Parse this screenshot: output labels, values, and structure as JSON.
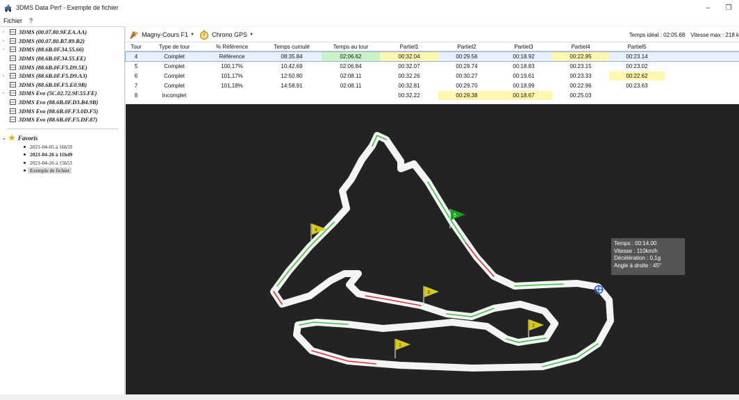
{
  "window": {
    "title": "3DMS Data Perf - Exemple de fichier",
    "minimize_glyph": "–",
    "restore_glyph": "❐"
  },
  "menu": [
    "Fichier",
    "?"
  ],
  "devices": [
    "3DMS (00.07.80.9F.EA.AA)",
    "3DMS (00.07.80.B7.89.B2)",
    "3DMS (88.6B.0F.34.55.66)",
    "3DMS (88.6B.0F.34.55.EE)",
    "3DMS (88.6B.0F.F5.D9.5E)",
    "3DMS (88.6B.0F.F5.D9.A3)",
    "3DMS (88.6B.0F.F5.E0.9B)",
    "3DMS Evo (5C.02.72.9F.55.FE)",
    "3DMS Evo (88.6B.0F.D3.B4.9B)",
    "3DMS Evo (88.6B.0F.F3.0D.F5)",
    "3DMS Evo (88.6B.0F.F5.DF.87)"
  ],
  "favorites": {
    "label": "Favoris",
    "items": [
      {
        "label": "2021-04-05 à 16h59",
        "bold": false,
        "selected": false
      },
      {
        "label": "2021-04-26 à 11h49",
        "bold": true,
        "selected": false
      },
      {
        "label": "2021-04-26 à 15h53",
        "bold": false,
        "selected": false
      },
      {
        "label": "Exemple de fichier",
        "bold": false,
        "selected": true
      }
    ]
  },
  "toolbar": {
    "circuit": "Magny-Cours F1",
    "timing": "Chrono GPS",
    "ideal_time": "Temps idéal : 02:05.68",
    "max_speed": "Vitesse max : 218 k"
  },
  "table": {
    "columns": [
      "Tour",
      "Type de tour",
      "% Référence",
      "Temps cumulé",
      "Temps au tour",
      "Partiel1",
      "Partiel2",
      "Partiel3",
      "Partiel4",
      "Partiel5"
    ],
    "rows": [
      {
        "cells": [
          "4",
          "Complet",
          "Référence",
          "08:35.84",
          "02:06.62",
          "00:32.04",
          "00:29.56",
          "00:18.92",
          "00:22.95",
          "00:23.14"
        ],
        "selected": true,
        "highlights": {
          "4": "green",
          "5": "yellow",
          "8": "yellow"
        }
      },
      {
        "cells": [
          "5",
          "Complet",
          "100,17%",
          "10:42.69",
          "02:06.84",
          "00:32.07",
          "00:29.74",
          "00:18.83",
          "00:23.15",
          "00:23.02"
        ],
        "selected": false,
        "highlights": {}
      },
      {
        "cells": [
          "6",
          "Complet",
          "101,17%",
          "12:50.80",
          "02:08.11",
          "00:32.26",
          "00:30.27",
          "00:19.61",
          "00:23.33",
          "00:22.62"
        ],
        "selected": false,
        "highlights": {
          "9": "yellow"
        }
      },
      {
        "cells": [
          "7",
          "Complet",
          "101,18%",
          "14:58.91",
          "02:08.11",
          "00:32.81",
          "00:29.70",
          "00:18.99",
          "00:22.96",
          "00:23.63"
        ],
        "selected": false,
        "highlights": {}
      },
      {
        "cells": [
          "8",
          "Incomplet",
          "",
          "",
          "",
          "00:32.22",
          "00:29.38",
          "00:18.67",
          "00:25.03",
          ""
        ],
        "selected": false,
        "highlights": {
          "6": "yellow",
          "7": "yellow"
        }
      }
    ]
  },
  "track": {
    "flags": [
      {
        "label": "1",
        "color": "yellow"
      },
      {
        "label": "2",
        "color": "yellow"
      },
      {
        "label": "3",
        "color": "yellow"
      },
      {
        "label": "4",
        "color": "yellow"
      },
      {
        "label": "5",
        "color": "green"
      }
    ],
    "tooltip": {
      "time": "Temps : 00:14.00",
      "speed": "Vitesse : 110km/h",
      "decel": "Décélération : 0,1g",
      "angle": "Angle à droite : 45°"
    }
  },
  "colors": {
    "track_bg": "#232323",
    "track_surface": "#f4f4f4",
    "faster_line": "#3cc43c",
    "slower_line": "#e03030",
    "flag_yellow": "#d8cc10",
    "flag_green": "#17a417",
    "marker_blue": "#2a5bd7"
  }
}
